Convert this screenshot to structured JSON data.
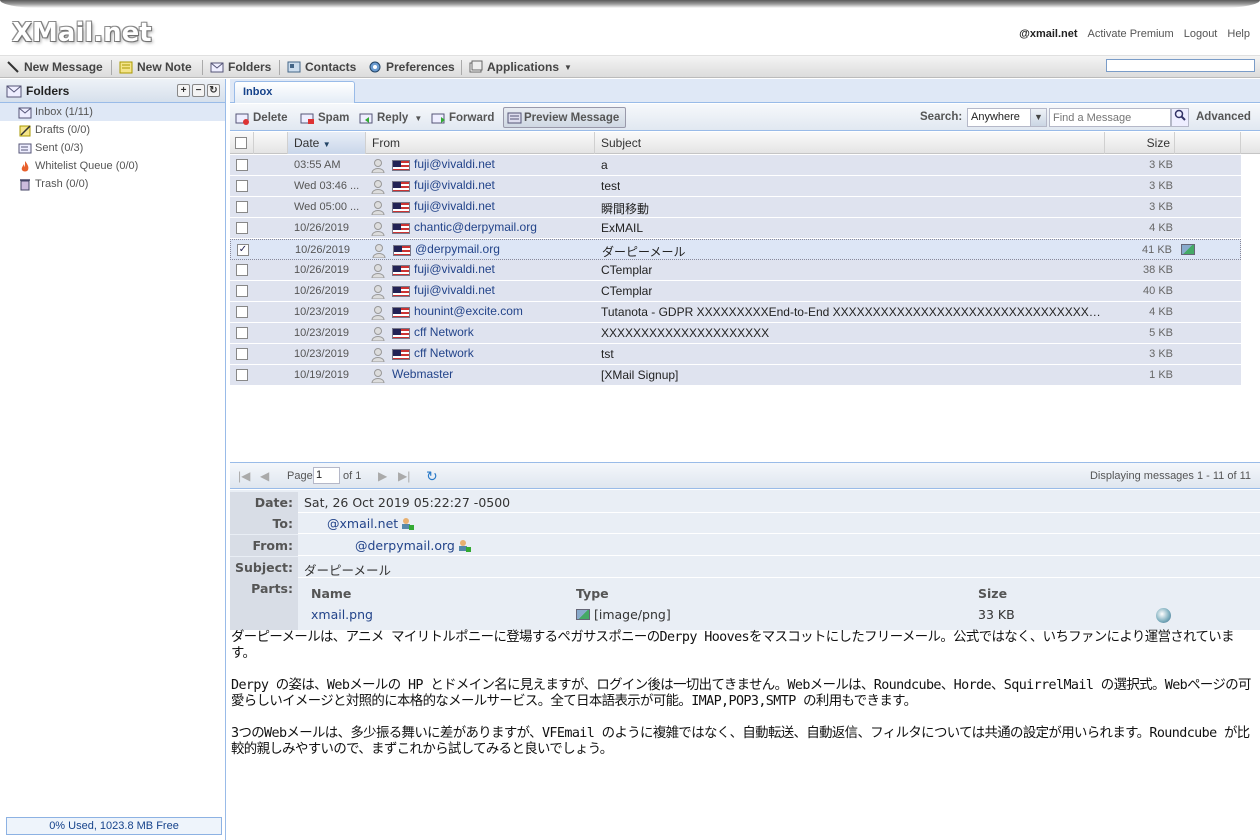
{
  "header": {
    "logo": "XMail.net",
    "account": "@xmail.net",
    "links": [
      "Activate Premium",
      "Logout",
      "Help"
    ]
  },
  "toolbar": {
    "new_message": "New Message",
    "new_note": "New Note",
    "folders": "Folders",
    "contacts": "Contacts",
    "preferences": "Preferences",
    "applications": "Applications"
  },
  "sidebar": {
    "title": "Folders",
    "folders": [
      {
        "label": "Inbox (1/11)",
        "icon": "inbox-icon"
      },
      {
        "label": "Drafts (0/0)",
        "icon": "drafts-icon"
      },
      {
        "label": "Sent (0/3)",
        "icon": "sent-icon"
      },
      {
        "label": "Whitelist Queue (0/0)",
        "icon": "fire-icon"
      },
      {
        "label": "Trash (0/0)",
        "icon": "trash-icon"
      }
    ],
    "storage": "0% Used, 1023.8 MB Free"
  },
  "tabs": [
    {
      "label": "Inbox"
    }
  ],
  "inbox_toolbar": {
    "delete": "Delete",
    "spam": "Spam",
    "reply": "Reply",
    "forward": "Forward",
    "preview": "Preview Message",
    "search_label": "Search:",
    "search_scope": "Anywhere",
    "search_placeholder": "Find a Message",
    "advanced": "Advanced"
  },
  "grid": {
    "columns": {
      "date": "Date",
      "from": "From",
      "subject": "Subject",
      "size": "Size"
    },
    "rows": [
      {
        "date": "03:55 AM",
        "from": "fuji@vivaldi.net",
        "subject": "a",
        "size": "3 KB",
        "checked": "",
        "flag": true
      },
      {
        "date": "Wed 03:46 ...",
        "from": "fuji@vivaldi.net",
        "subject": "test",
        "size": "3 KB",
        "checked": "",
        "flag": true
      },
      {
        "date": "Wed 05:00 ...",
        "from": "fuji@vivaldi.net",
        "subject": "瞬間移動",
        "size": "3 KB",
        "checked": "",
        "flag": true
      },
      {
        "date": "10/26/2019",
        "from": "chantic@derpymail.org",
        "subject": "ExMAIL",
        "size": "4 KB",
        "checked": "",
        "flag": true
      },
      {
        "date": "10/26/2019",
        "from": "@derpymail.org",
        "subject": "ダーピーメール",
        "size": "41 KB",
        "checked": "✓",
        "flag": true
      },
      {
        "date": "10/26/2019",
        "from": "fuji@vivaldi.net",
        "subject": "CTemplar",
        "size": "38 KB",
        "checked": "",
        "flag": true
      },
      {
        "date": "10/26/2019",
        "from": "fuji@vivaldi.net",
        "subject": "CTemplar",
        "size": "40 KB",
        "checked": "",
        "flag": true
      },
      {
        "date": "10/23/2019",
        "from": "hounint@excite.com",
        "subject": "Tutanota - GDPR XXXXXXXXXEnd-to-End XXXXXXXXXXXXXXXXXXXXXXXXXXXXXXXXX...",
        "size": "4 KB",
        "checked": "",
        "flag": true
      },
      {
        "date": "10/23/2019",
        "from": "cff Network",
        "subject": "XXXXXXXXXXXXXXXXXXXXX",
        "size": "5 KB",
        "checked": "",
        "flag": true
      },
      {
        "date": "10/23/2019",
        "from": "cff Network",
        "subject": "tst",
        "size": "3 KB",
        "checked": "",
        "flag": true
      },
      {
        "date": "10/19/2019",
        "from": "Webmaster",
        "subject": "[XMail Signup]",
        "size": "1 KB",
        "checked": "",
        "flag": false
      }
    ]
  },
  "pager": {
    "page_label": "Page",
    "page": "1",
    "of": "of 1",
    "display": "Displaying messages 1 - 11 of 11"
  },
  "preview": {
    "date_label": "Date:",
    "date": "Sat, 26 Oct 2019 05:22:27 -0500",
    "to_label": "To:",
    "to": "@xmail.net",
    "from_label": "From:",
    "from": "@derpymail.org",
    "subject_label": "Subject:",
    "subject": "ダーピーメール",
    "parts_label": "Parts:",
    "parts_cols": {
      "name": "Name",
      "type": "Type",
      "size": "Size"
    },
    "part": {
      "name": "xmail.png",
      "type": "[image/png]",
      "size": "33 KB"
    }
  },
  "body": {
    "p1": "ダーピーメールは、アニメ マイリトルポニーに登場するペガサスポニーのDerpy Hoovesをマスコットにしたフリーメール。公式ではなく、いちファンにより運営されています。",
    "p2": "Derpy の姿は、Webメールの HP とドメイン名に見えますが、ログイン後は一切出てきません。Webメールは、Roundcube、Horde、SquirrelMail の選択式。Webページの可愛らしいイメージと対照的に本格的なメールサービス。全て日本語表示が可能。IMAP,POP3,SMTP の利用もできます。",
    "p3": "3つのWebメールは、多少振る舞いに差がありますが、VFEmail のように複雑ではなく、自動転送、自動返信、フィルタについては共通の設定が用いられます。Roundcube が比較的親しみやすいので、まずこれから試してみると良いでしょう。"
  }
}
